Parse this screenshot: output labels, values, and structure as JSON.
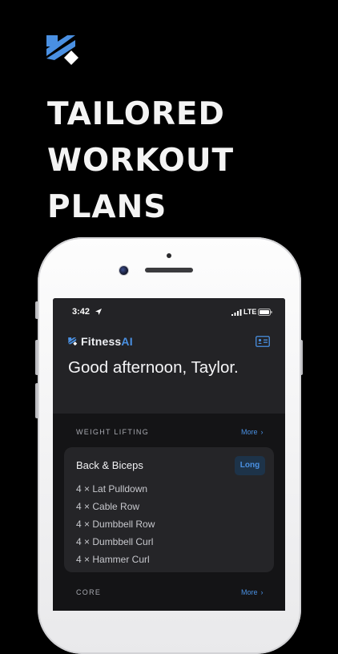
{
  "hero": {
    "headline_lines": [
      "TAILORED",
      "WORKOUT",
      "PLANS"
    ],
    "logo_icon": "fitnessai-k-logo-icon"
  },
  "colors": {
    "accent": "#4a90e2",
    "background": "#000000",
    "screen_bg": "#141416",
    "card_bg": "#252528",
    "badge_bg": "#1d3349"
  },
  "status_bar": {
    "time": "3:42",
    "location_icon": "location-arrow-icon",
    "signal_icon": "cellular-signal-icon",
    "network": "LTE",
    "battery_icon": "battery-icon"
  },
  "app_header": {
    "brand_part1": "Fitness",
    "brand_part2": "AI",
    "profile_icon": "profile-card-icon",
    "greeting": "Good afternoon, Taylor."
  },
  "sections": {
    "weight_lifting": {
      "label": "WEIGHT LIFTING",
      "more": "More"
    },
    "core": {
      "label": "CORE",
      "more": "More"
    }
  },
  "workout_card": {
    "title": "Back & Biceps",
    "badge": "Long",
    "exercises": [
      "4 × Lat Pulldown",
      "4 × Cable Row",
      "4 × Dumbbell Row",
      "4 × Dumbbell Curl",
      "4 × Hammer Curl"
    ]
  }
}
